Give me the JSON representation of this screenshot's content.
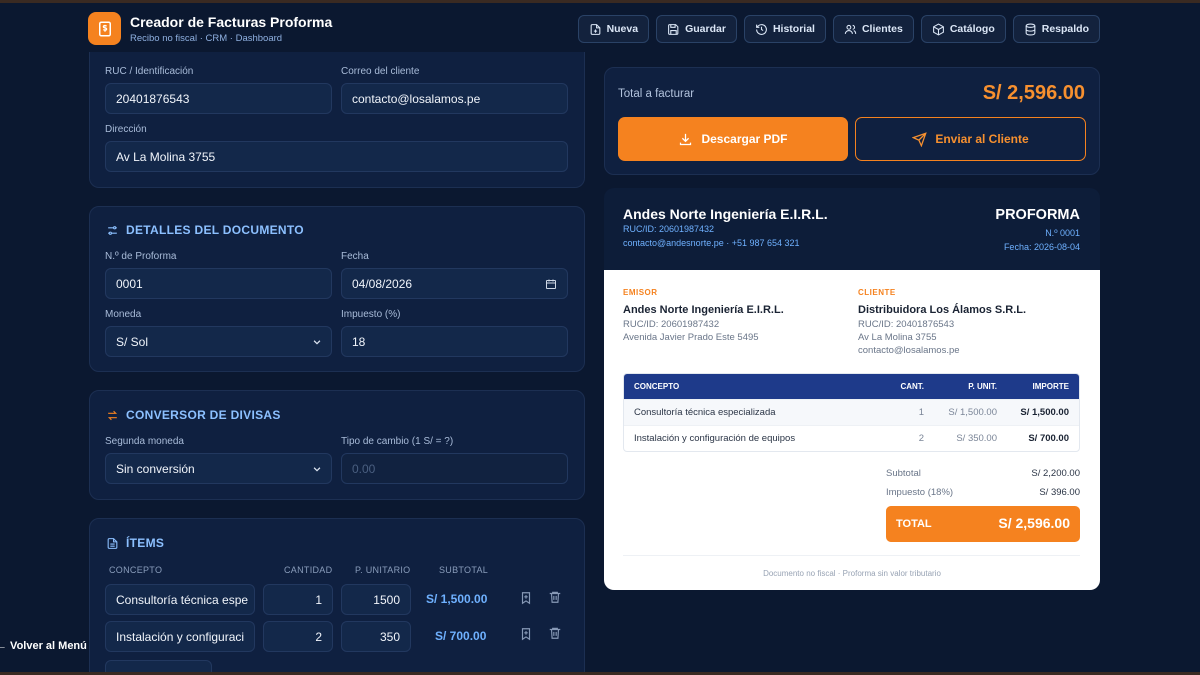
{
  "header": {
    "title": "Creador de Facturas Proforma",
    "subtitle": "Recibo no fiscal · CRM · Dashboard",
    "nav": [
      "Nueva",
      "Guardar",
      "Historial",
      "Clientes",
      "Catálogo",
      "Respaldo"
    ]
  },
  "client": {
    "ruc_label": "RUC / Identificación",
    "ruc_value": "20401876543",
    "email_label": "Correo del cliente",
    "email_value": "contacto@losalamos.pe",
    "address_label": "Dirección",
    "address_value": "Av La Molina 3755"
  },
  "doc": {
    "section_title": "DETALLES DEL DOCUMENTO",
    "number_label": "N.º de Proforma",
    "number_value": "0001",
    "date_label": "Fecha",
    "date_value": "04/08/2026",
    "currency_label": "Moneda",
    "currency_value": "S/ Sol",
    "tax_label": "Impuesto (%)",
    "tax_value": "18"
  },
  "converter": {
    "section_title": "CONVERSOR DE DIVISAS",
    "second_label": "Segunda moneda",
    "second_value": "Sin conversión",
    "rate_label": "Tipo de cambio (1 S/ = ?)",
    "rate_placeholder": "0.00"
  },
  "items": {
    "section_title": "ÍTEMS",
    "columns": [
      "CONCEPTO",
      "CANTIDAD",
      "P. UNITARIO",
      "SUBTOTAL"
    ],
    "rows": [
      {
        "concept": "Consultoría técnica espe",
        "qty": "1",
        "price": "1500",
        "subtotal": "S/ 1,500.00"
      },
      {
        "concept": "Instalación y configuraci",
        "qty": "2",
        "price": "350",
        "subtotal": "S/ 700.00"
      }
    ]
  },
  "summary": {
    "total_label": "Total a facturar",
    "total_value": "S/ 2,596.00",
    "pdf_button": "Descargar PDF",
    "send_button": "Enviar al Cliente"
  },
  "preview": {
    "company": "Andes Norte Ingeniería E.I.R.L.",
    "company_ruc": "RUC/ID: 20601987432",
    "company_contact": "contacto@andesnorte.pe · +51 987 654 321",
    "doc_title": "PROFORMA",
    "doc_number": "N.º 0001",
    "doc_date": "Fecha: 2026-08-04",
    "emisor_tag": "EMISOR",
    "emisor_name": "Andes Norte Ingeniería E.I.R.L.",
    "emisor_ruc": "RUC/ID: 20601987432",
    "emisor_address": "Avenida Javier Prado Este 5495",
    "cliente_tag": "CLIENTE",
    "cliente_name": "Distribuidora Los Álamos S.R.L.",
    "cliente_ruc": "RUC/ID: 20401876543",
    "cliente_address": "Av La Molina 3755",
    "cliente_email": "contacto@losalamos.pe",
    "table_headers": [
      "CONCEPTO",
      "CANT.",
      "P. UNIT.",
      "IMPORTE"
    ],
    "table_rows": [
      {
        "concept": "Consultoría técnica especializada",
        "qty": "1",
        "unit": "S/ 1,500.00",
        "amount": "S/ 1,500.00"
      },
      {
        "concept": "Instalación y configuración de equipos",
        "qty": "2",
        "unit": "S/ 350.00",
        "amount": "S/ 700.00"
      }
    ],
    "subtotal_label": "Subtotal",
    "subtotal_value": "S/ 2,200.00",
    "tax_label": "Impuesto (18%)",
    "tax_value": "S/ 396.00",
    "total_label": "TOTAL",
    "total_value": "S/ 2,596.00",
    "footer": "Documento no fiscal · Proforma sin valor tributario"
  },
  "back_link": "← Volver al Menú",
  "colors": {
    "accent": "#f5821f",
    "bg": "#0b1830",
    "card": "#0f2040",
    "link": "#6fb1ff"
  }
}
